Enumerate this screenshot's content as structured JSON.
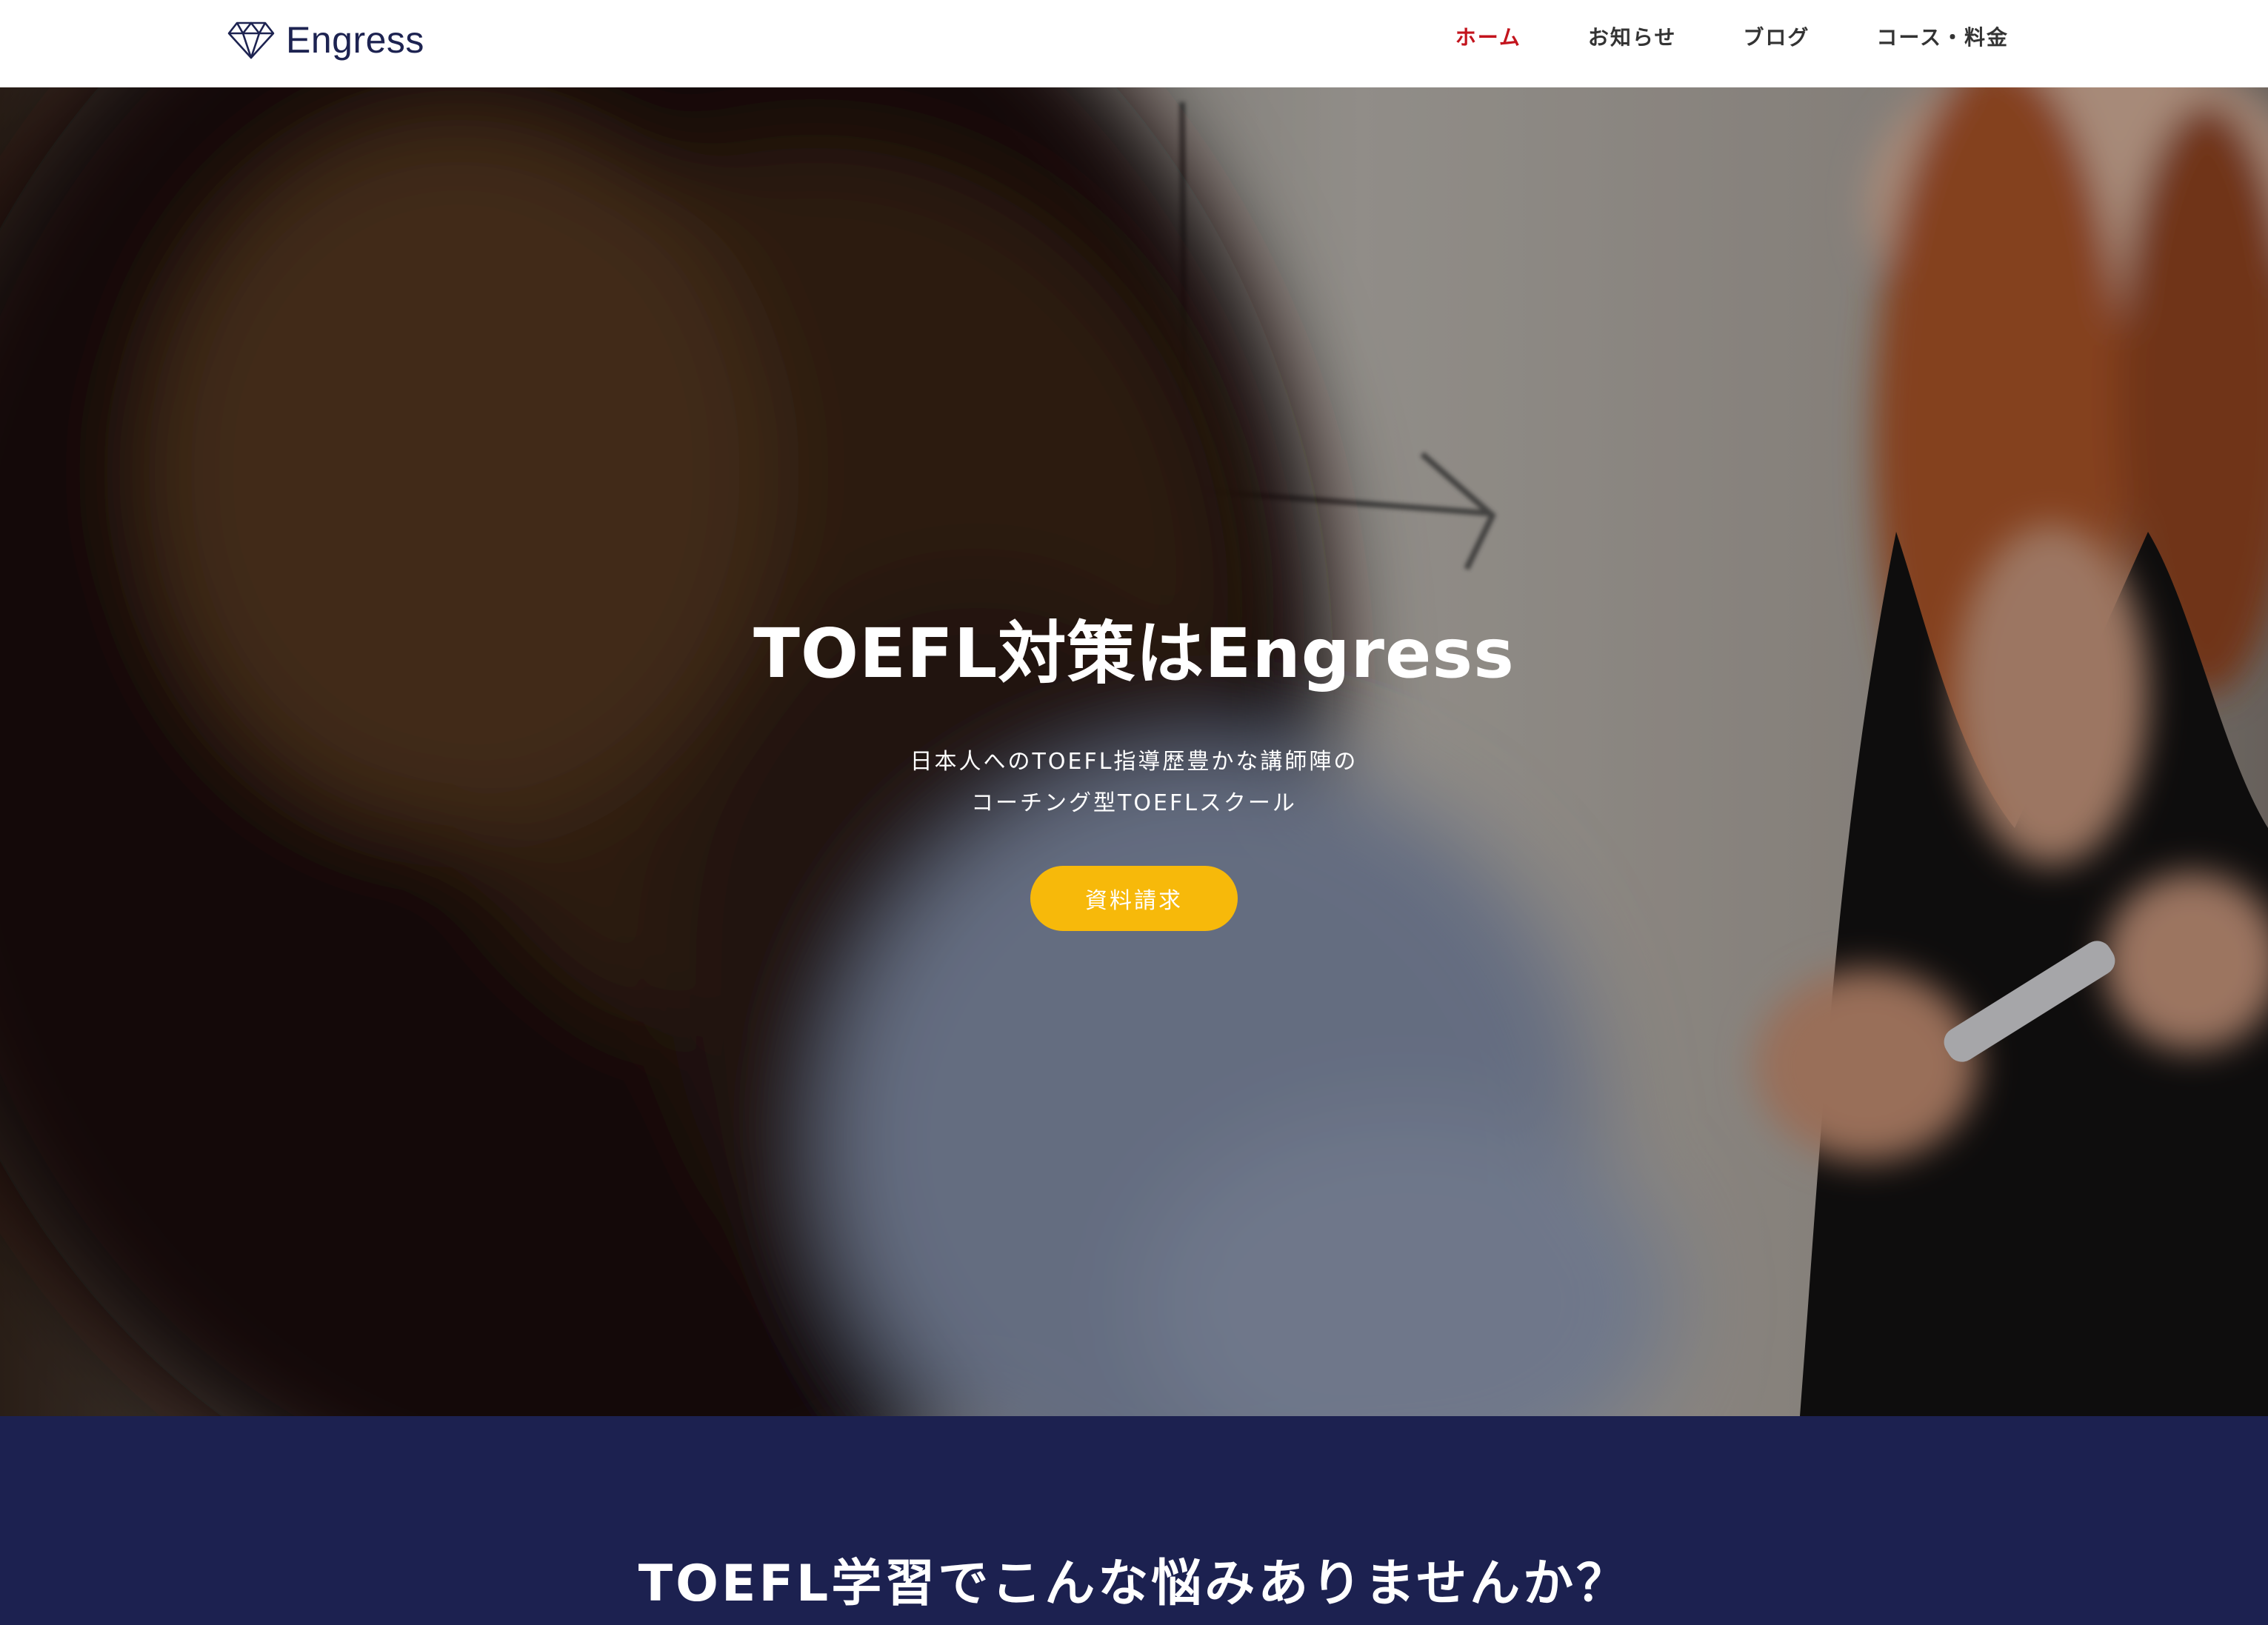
{
  "header": {
    "logo_text": "Engress",
    "nav": [
      {
        "label": "ホーム",
        "active": true
      },
      {
        "label": "お知らせ",
        "active": false
      },
      {
        "label": "ブログ",
        "active": false
      },
      {
        "label": "コース・料金",
        "active": false
      }
    ]
  },
  "hero": {
    "title": "TOEFL対策はEngress",
    "subtitle_line1": "日本人へのTOEFL指導歴豊かな講師陣の",
    "subtitle_line2": "コーチング型TOEFLスクール",
    "cta_label": "資料請求"
  },
  "problems": {
    "title": "TOEFL学習でこんな悩みありませんか？"
  },
  "colors": {
    "brand_navy": "#1c2150",
    "nav_active": "#c3141d",
    "cta_yellow": "#f7b90a"
  },
  "icons": {
    "logo_icon": "diamond-icon"
  }
}
